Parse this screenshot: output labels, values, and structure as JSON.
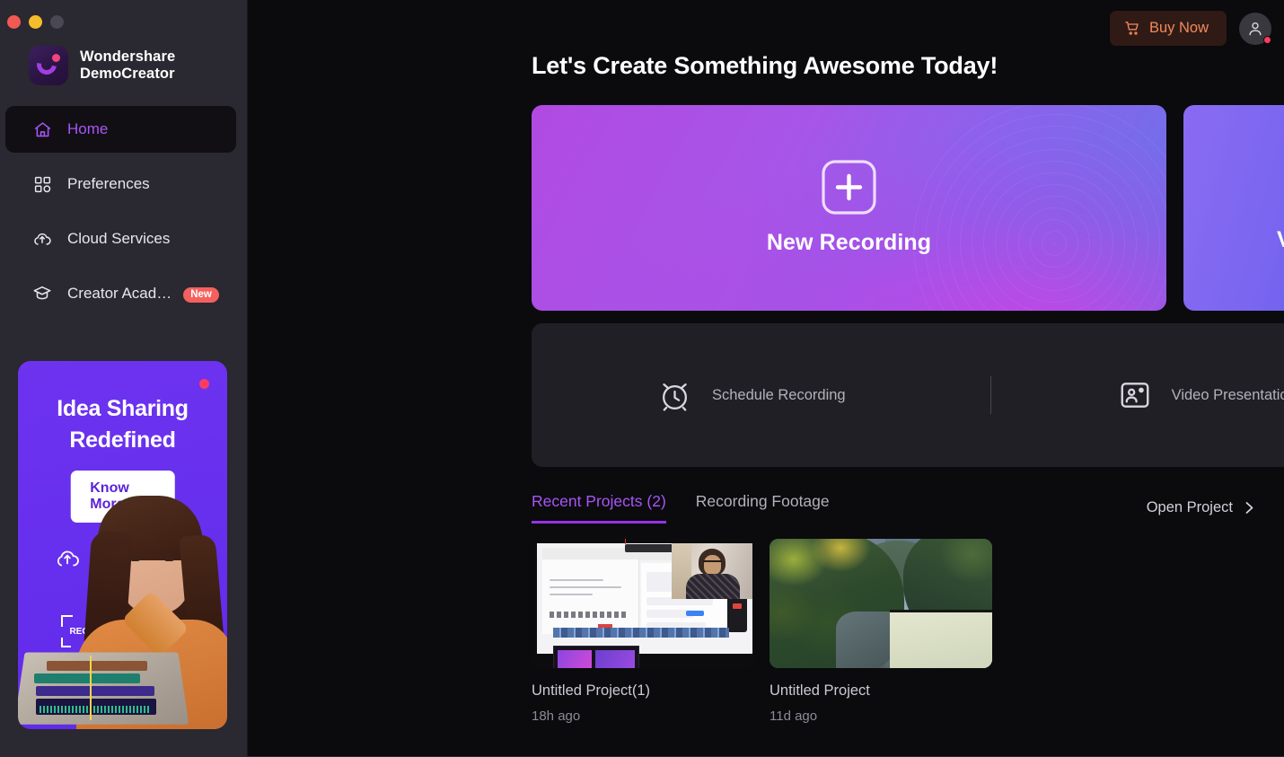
{
  "window": {
    "controls": [
      "close",
      "minimize",
      "maximize-disabled"
    ]
  },
  "sidebar": {
    "brand": {
      "line1": "Wondershare",
      "line2": "DemoCreator"
    },
    "items": [
      {
        "label": "Home",
        "icon": "home-icon",
        "active": true
      },
      {
        "label": "Preferences",
        "icon": "grid-icon",
        "active": false
      },
      {
        "label": "Cloud Services",
        "icon": "cloud-upload-icon",
        "active": false
      },
      {
        "label": "Creator Acad…",
        "icon": "graduation-cap-icon",
        "active": false,
        "badge": "New"
      }
    ],
    "promo": {
      "title": "Idea Sharing\nRedefined",
      "title_line1": "Idea Sharing",
      "title_line2": "Redefined",
      "button": "Know More",
      "rec_label": "REC"
    }
  },
  "topbar": {
    "buy_now": "Buy Now",
    "buy_now_icon": "shopping-cart-icon",
    "avatar_icon": "user-icon"
  },
  "main": {
    "page_title": "Let's Create Something Awesome Today!",
    "cards": [
      {
        "label": "New Recording",
        "icon": "plus-square-icon"
      },
      {
        "label": "Video Editor",
        "icon": "play-rectangle-icon"
      }
    ],
    "quick_actions": [
      {
        "label": "Schedule Recording",
        "icon": "alarm-clock-icon"
      },
      {
        "label": "Video Presentation",
        "icon": "presentation-person-icon"
      }
    ],
    "tabs": [
      {
        "label": "Recent Projects (2)",
        "active": true
      },
      {
        "label": "Recording Footage",
        "active": false
      }
    ],
    "open_project": {
      "label": "Open Project",
      "icon": "chevron-right-icon"
    },
    "projects": [
      {
        "name": "Untitled Project(1)",
        "time": "18h ago",
        "thumb": "screen-recording-with-webcam"
      },
      {
        "name": "Untitled Project",
        "time": "11d ago",
        "thumb": "river-landscape"
      }
    ]
  },
  "colors": {
    "app_bg": "#0b0a0d",
    "sidebar_bg": "#2a2830",
    "panel_bg": "#211f26",
    "accent_purple": "#a855f7",
    "buy_now_text": "#f08a5c",
    "buy_now_bg": "#301a16",
    "badge_new": "#f4605e",
    "promo_bg": "#6730ee",
    "card_recording_gradient": [
      "#b14ae2",
      "#6a72e8"
    ],
    "card_editor_gradient": [
      "#8a6bf2",
      "#4a52e2"
    ]
  }
}
